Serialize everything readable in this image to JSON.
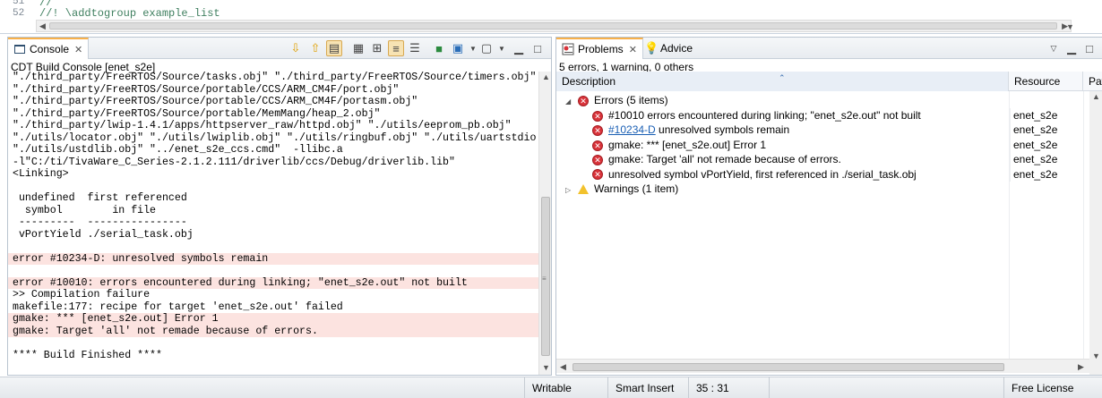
{
  "editor": {
    "lines": [
      {
        "num": "51",
        "text": "//"
      },
      {
        "num": "52",
        "text": "//! \\addtogroup example_list"
      }
    ]
  },
  "console": {
    "tab_label": "Console",
    "subtitle": "CDT Build Console [enet_s2e]",
    "lines": [
      {
        "text": "\"./third_party/FreeRTOS/Source/tasks.obj\" \"./third_party/FreeRTOS/Source/timers.obj\"",
        "error": false
      },
      {
        "text": "\"./third_party/FreeRTOS/Source/portable/CCS/ARM_CM4F/port.obj\"",
        "error": false
      },
      {
        "text": "\"./third_party/FreeRTOS/Source/portable/CCS/ARM_CM4F/portasm.obj\"",
        "error": false
      },
      {
        "text": "\"./third_party/FreeRTOS/Source/portable/MemMang/heap_2.obj\"",
        "error": false
      },
      {
        "text": "\"./third_party/lwip-1.4.1/apps/httpserver_raw/httpd.obj\" \"./utils/eeprom_pb.obj\"",
        "error": false
      },
      {
        "text": "\"./utils/locator.obj\" \"./utils/lwiplib.obj\" \"./utils/ringbuf.obj\" \"./utils/uartstdio.obj\"",
        "error": false
      },
      {
        "text": "\"./utils/ustdlib.obj\" \"../enet_s2e_ccs.cmd\"  -llibc.a",
        "error": false
      },
      {
        "text": "-l\"C:/ti/TivaWare_C_Series-2.1.2.111/driverlib/ccs/Debug/driverlib.lib\"",
        "error": false
      },
      {
        "text": "<Linking>",
        "error": false
      },
      {
        "text": "",
        "error": false
      },
      {
        "text": " undefined  first referenced",
        "error": false
      },
      {
        "text": "  symbol        in file",
        "error": false
      },
      {
        "text": " ---------  ----------------",
        "error": false
      },
      {
        "text": " vPortYield ./serial_task.obj",
        "error": false
      },
      {
        "text": "",
        "error": false
      },
      {
        "text": "error #10234-D: unresolved symbols remain",
        "error": true
      },
      {
        "text": "",
        "error": false
      },
      {
        "text": "error #10010: errors encountered during linking; \"enet_s2e.out\" not built",
        "error": true
      },
      {
        "text": ">> Compilation failure",
        "error": false
      },
      {
        "text": "makefile:177: recipe for target 'enet_s2e.out' failed",
        "error": false
      },
      {
        "text": "gmake: *** [enet_s2e.out] Error 1",
        "error": true
      },
      {
        "text": "gmake: Target 'all' not remade because of errors.",
        "error": true
      },
      {
        "text": "",
        "error": false
      },
      {
        "text": "**** Build Finished ****",
        "error": false
      }
    ]
  },
  "problems": {
    "tab_label": "Problems",
    "advice_label": "Advice",
    "summary": "5 errors, 1 warning, 0 others",
    "columns": [
      "Description",
      "Resource",
      "Pat"
    ],
    "errors_group": "Errors (5 items)",
    "warnings_group": "Warnings (1 item)",
    "items": [
      {
        "link": "",
        "desc": "#10010 errors encountered during linking; \"enet_s2e.out\" not built",
        "resource": "enet_s2e"
      },
      {
        "link": "#10234-D",
        "desc": " unresolved symbols remain",
        "resource": "enet_s2e"
      },
      {
        "link": "",
        "desc": "gmake: *** [enet_s2e.out] Error 1",
        "resource": "enet_s2e"
      },
      {
        "link": "",
        "desc": "gmake: Target 'all' not remade because of errors.",
        "resource": "enet_s2e"
      },
      {
        "link": "",
        "desc": "unresolved symbol vPortYield, first referenced in ./serial_task.obj",
        "resource": "enet_s2e"
      }
    ]
  },
  "status": {
    "writable": "Writable",
    "insert_mode": "Smart Insert",
    "position": "35 : 31",
    "license": "Free License"
  }
}
